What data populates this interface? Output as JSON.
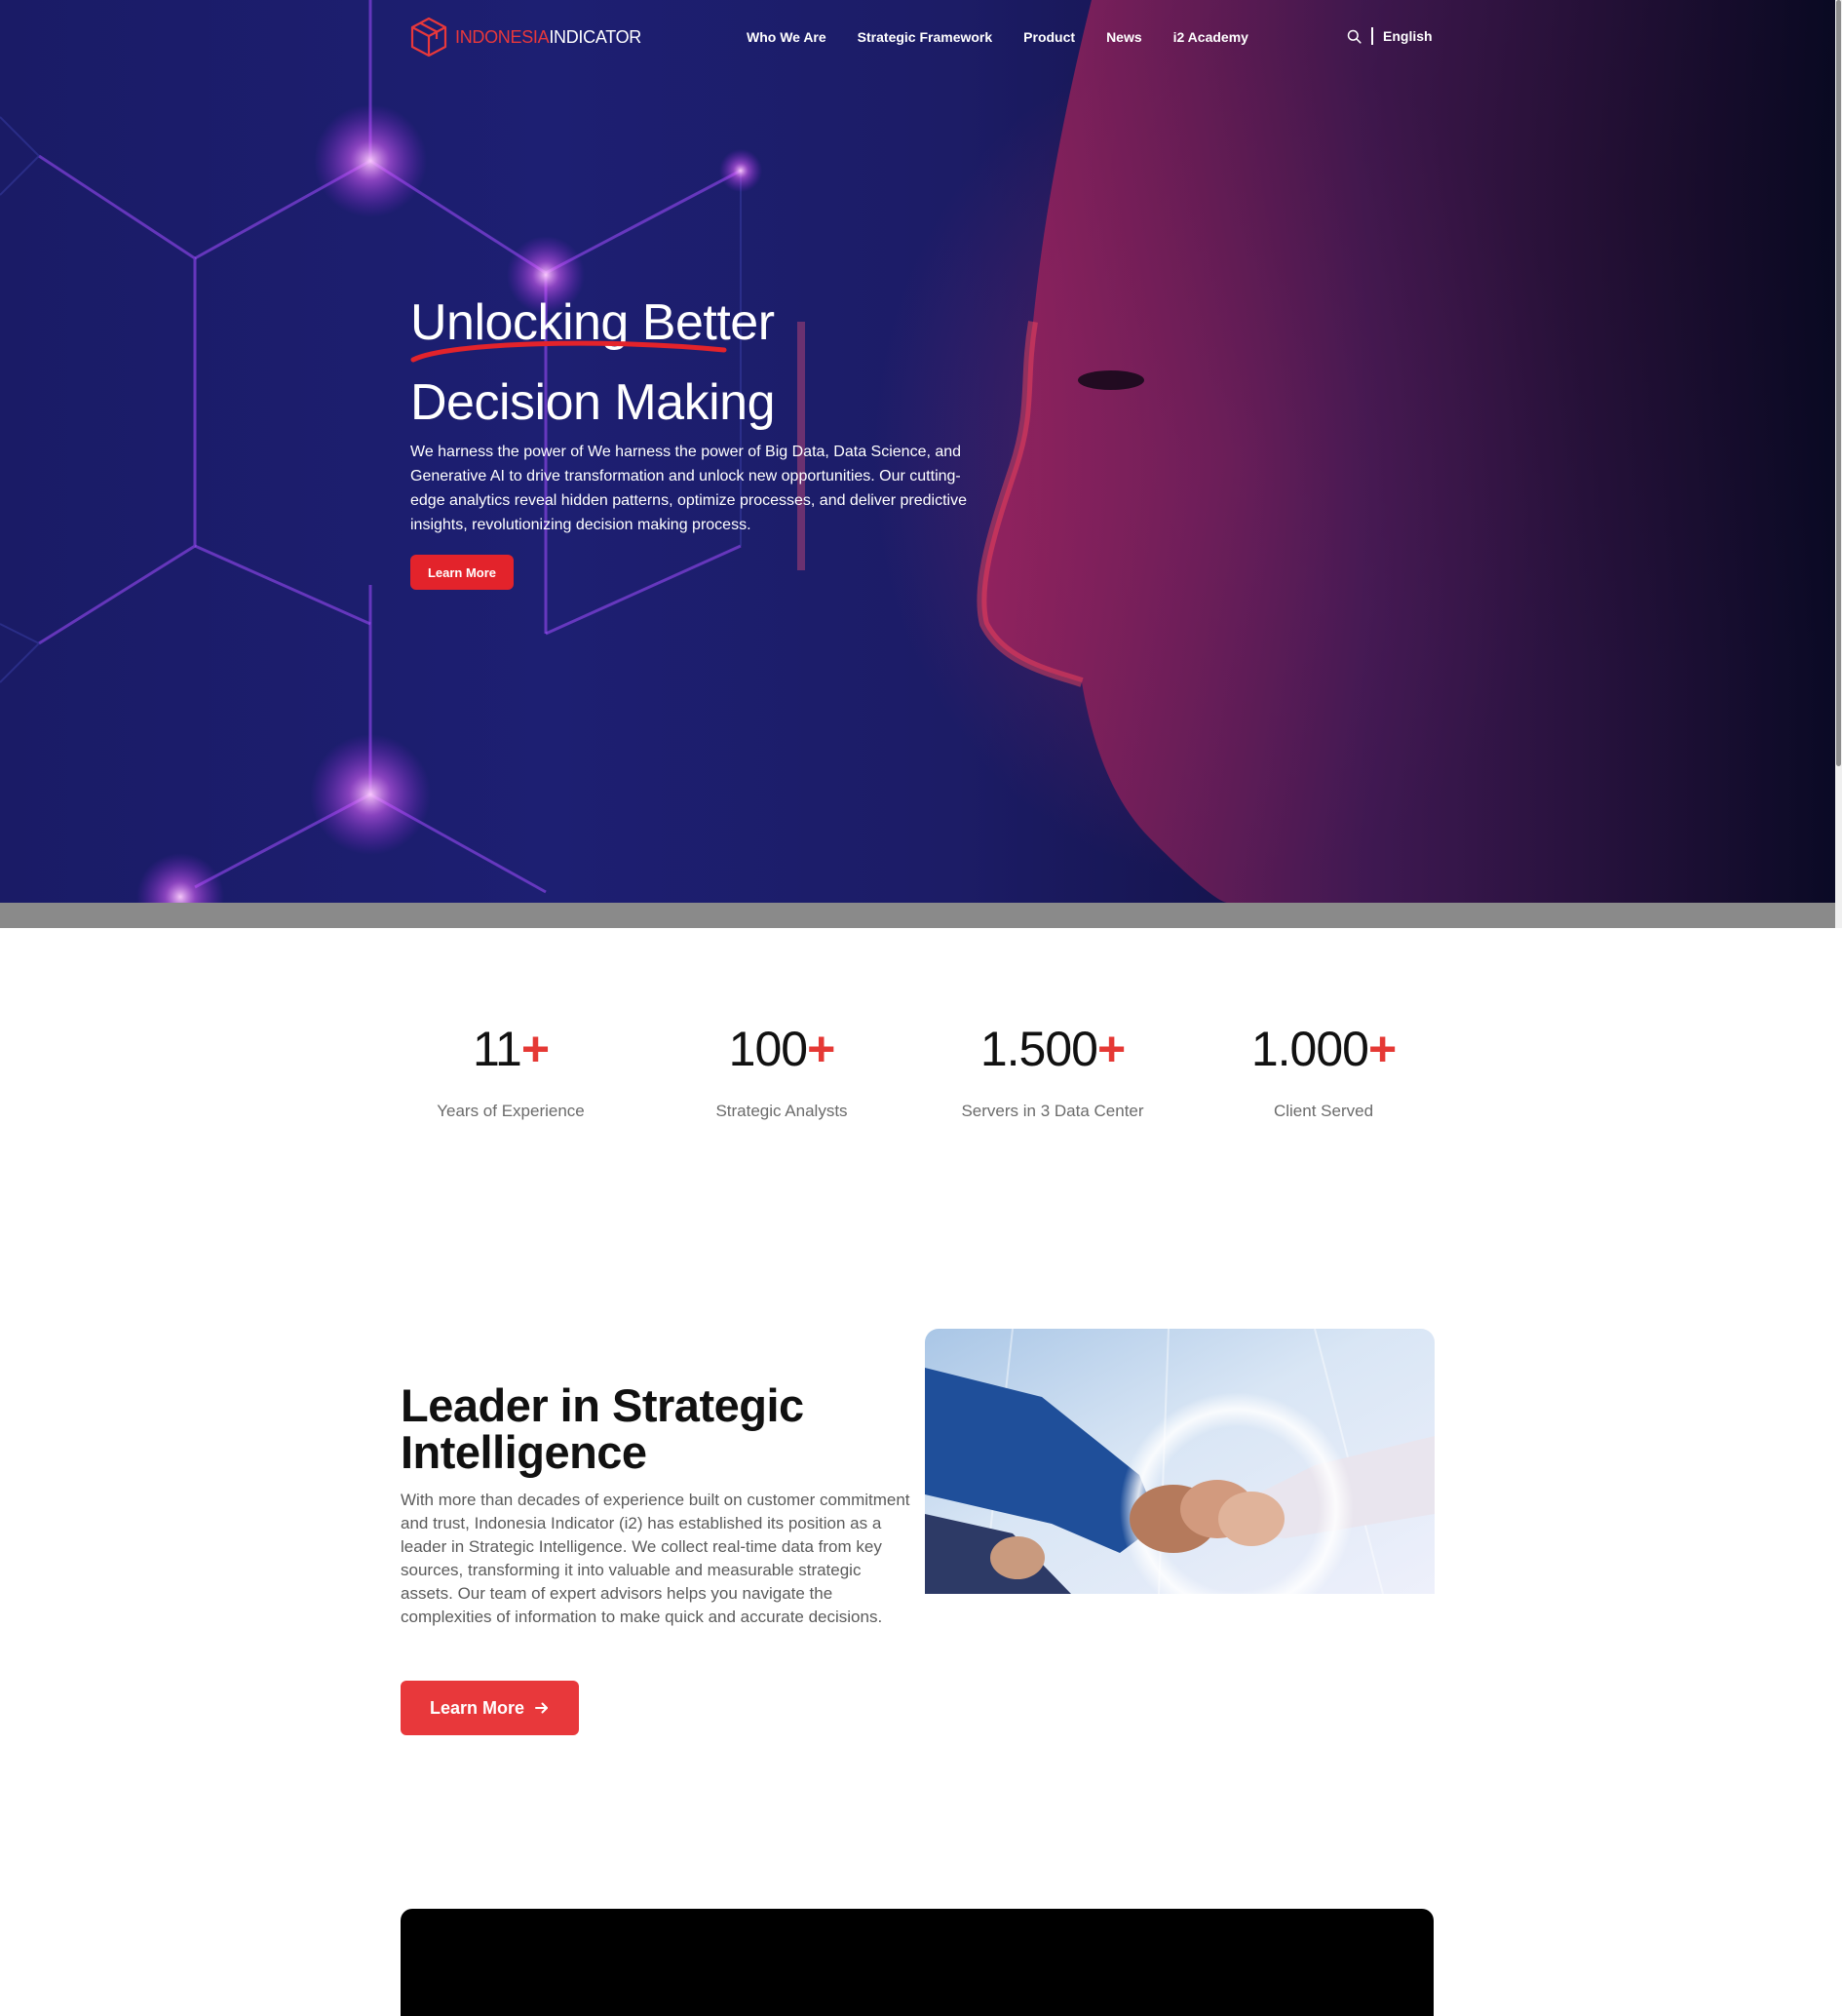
{
  "brand": {
    "name_part_1": "INDONESIA",
    "name_part_2": "INDICATOR",
    "accent": "#e3232b"
  },
  "nav": {
    "items": [
      {
        "label": "Who We Are"
      },
      {
        "label": "Strategic Framework"
      },
      {
        "label": "Product"
      },
      {
        "label": "News"
      },
      {
        "label": "i2 Academy"
      }
    ],
    "search_icon": "search-icon",
    "language": "English"
  },
  "hero": {
    "title_line_1": "Unlocking Better",
    "title_line_2": "Decision Making",
    "description": "We harness the power of We harness the power of Big Data, Data Science, and Generative AI to drive transformation and unlock new opportunities. Our cutting-edge analytics reveal hidden patterns, optimize processes, and deliver predictive insights, revolutionizing decision making process.",
    "cta": "Learn More"
  },
  "stats": [
    {
      "value": "11",
      "suffix": "+",
      "label": "Years of Experience"
    },
    {
      "value": "100",
      "suffix": "+",
      "label": "Strategic Analysts"
    },
    {
      "value": "1.500",
      "suffix": "+",
      "label": "Servers in 3 Data Center"
    },
    {
      "value": "1.000",
      "suffix": "+",
      "label": "Client Served"
    }
  ],
  "leader": {
    "title": "Leader in Strategic Intelligence",
    "description": "With more than decades of experience built on customer commitment and trust, Indonesia Indicator (i2) has established its position as a leader in Strategic Intelligence. We collect real-time data from key sources, transforming it into valuable and measurable strategic assets. Our team of expert advisors helps you navigate the complexities of information to make quick and accurate decisions.",
    "cta": "Learn More",
    "cta_icon": "arrow-right-icon"
  }
}
